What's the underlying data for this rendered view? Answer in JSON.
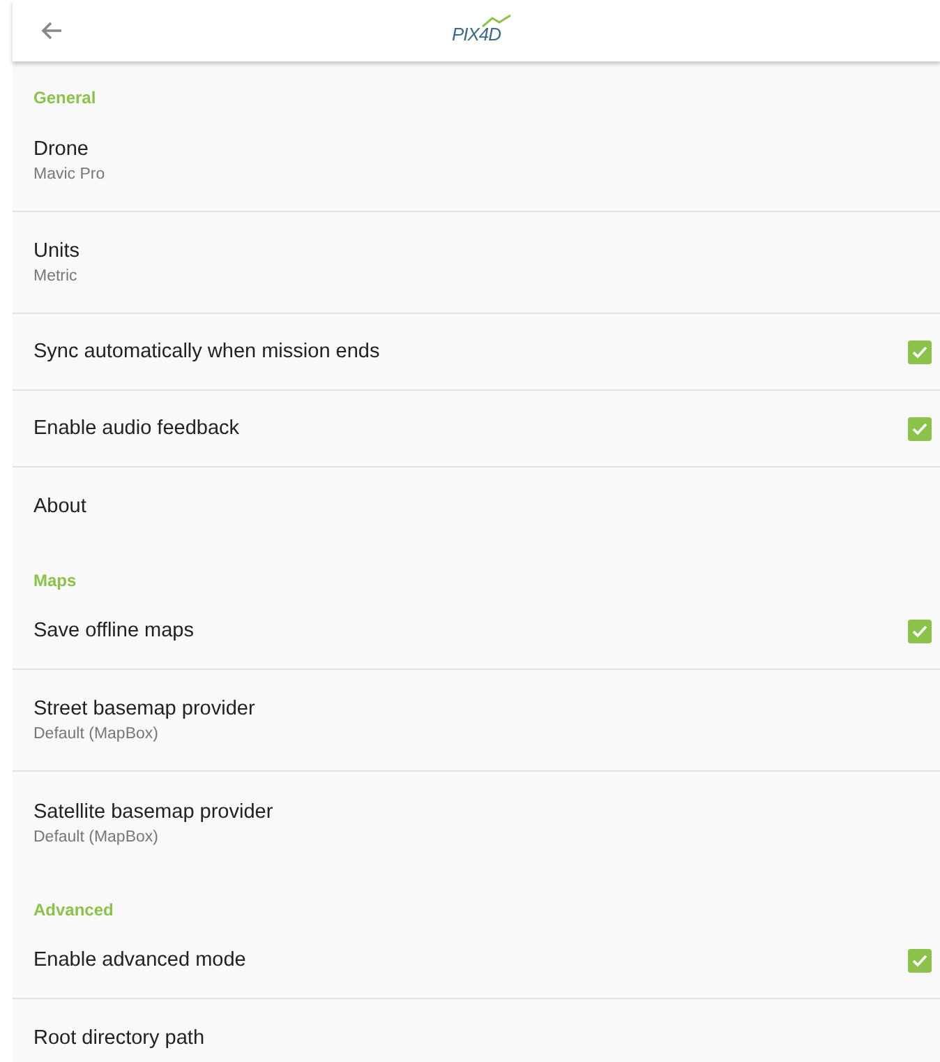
{
  "app_bar": {
    "logo": "PIX4D"
  },
  "sections": [
    {
      "title": "General",
      "items": [
        {
          "kind": "detail",
          "title": "Drone",
          "subtitle": "Mavic Pro"
        },
        {
          "kind": "detail",
          "title": "Units",
          "subtitle": "Metric"
        },
        {
          "kind": "checkbox",
          "title": "Sync automatically when mission ends",
          "checked": true
        },
        {
          "kind": "checkbox",
          "title": "Enable audio feedback",
          "checked": true
        },
        {
          "kind": "plain",
          "title": "About"
        }
      ]
    },
    {
      "title": "Maps",
      "items": [
        {
          "kind": "checkbox",
          "title": "Save offline maps",
          "checked": true
        },
        {
          "kind": "detail",
          "title": "Street basemap provider",
          "subtitle": "Default (MapBox)"
        },
        {
          "kind": "detail",
          "title": "Satellite basemap provider",
          "subtitle": "Default (MapBox)"
        }
      ]
    },
    {
      "title": "Advanced",
      "items": [
        {
          "kind": "checkbox",
          "title": "Enable advanced mode",
          "checked": true
        },
        {
          "kind": "plain",
          "title": "Root directory path"
        }
      ]
    }
  ]
}
